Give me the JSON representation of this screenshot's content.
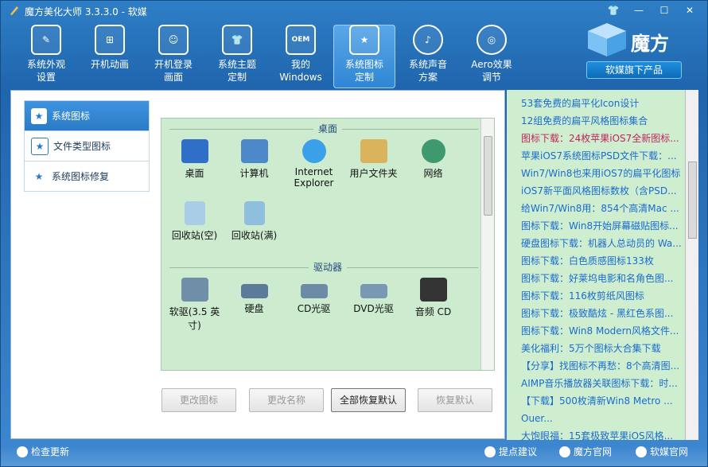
{
  "window": {
    "title": "魔方美化大师 3.3.3.0 - 软媒"
  },
  "toolbar": {
    "items": [
      {
        "label": "系统外观\n设置"
      },
      {
        "label": "开机动画"
      },
      {
        "label": "开机登录\n画面"
      },
      {
        "label": "系统主题\n定制"
      },
      {
        "label": "我的\nWindows"
      },
      {
        "label": "系统图标\n定制"
      },
      {
        "label": "系统声音\n方案"
      },
      {
        "label": "Aero效果\n调节"
      }
    ]
  },
  "brand": {
    "name": "魔方",
    "button": "软媒旗下产品"
  },
  "nav": {
    "items": [
      {
        "label": "系统图标"
      },
      {
        "label": "文件类型图标"
      },
      {
        "label": "系统图标修复"
      }
    ]
  },
  "panel": {
    "desktop_title": "桌面",
    "desktop_icons": [
      {
        "label": "桌面"
      },
      {
        "label": "计算机"
      },
      {
        "label": "Internet Explorer"
      },
      {
        "label": "用户文件夹"
      },
      {
        "label": "网络"
      },
      {
        "label": "回收站(空)"
      },
      {
        "label": "回收站(满)"
      }
    ],
    "drive_title": "驱动器",
    "drive_icons": [
      {
        "label": "软驱(3.5 英寸)"
      },
      {
        "label": "硬盘"
      },
      {
        "label": "CD光驱"
      },
      {
        "label": "DVD光驱"
      },
      {
        "label": "音频 CD"
      }
    ]
  },
  "buttons": {
    "change_icon": "更改图标",
    "change_name": "更改名称",
    "restore_all": "全部恢复默认",
    "restore": "恢复默认"
  },
  "side": {
    "links": [
      "53套免费的扁平化Icon设计",
      "12组免费的扁平风格图标集合",
      "图标下载：24枚苹果iOS7全新图标...",
      "苹果iOS7系统图标PSD文件下载：...",
      "Win7/Win8也来用iOS7的扁平化图标",
      "iOS7新平面风格图标数枚（含PSD...",
      "给Win7/Win8用：854个高清Mac ...",
      "图标下载：Win8开始屏幕磁贴图标...",
      "硬盘图标下载：机器人总动员的 Wa...",
      "图标下载：白色质感图标133枚",
      "图标下载：好莱坞电影和名角色图...",
      "图标下载：116枚剪纸风图标",
      "图标下载：极致酷炫 - 黑红色系图...",
      "图标下载：Win8 Modern风格文件...",
      "美化福利：5万个图标大合集下载",
      "【分享】找图标不再愁：8个高清图...",
      "AIMP音乐播放器关联图标下载：时...",
      "【下载】500枚清新Win8 Metro ...",
      "Ouer...",
      "大饱眼福：15套极致苹果iOS风格..."
    ],
    "highlight": [
      2
    ]
  },
  "status": {
    "update": "检查更新",
    "suggest": "提点建议",
    "site": "魔方官网",
    "media": "软媒官网"
  },
  "colors": {
    "accent": "#2a7bc6",
    "panel_bg": "#cdeccf",
    "link": "#1a6bd0"
  }
}
